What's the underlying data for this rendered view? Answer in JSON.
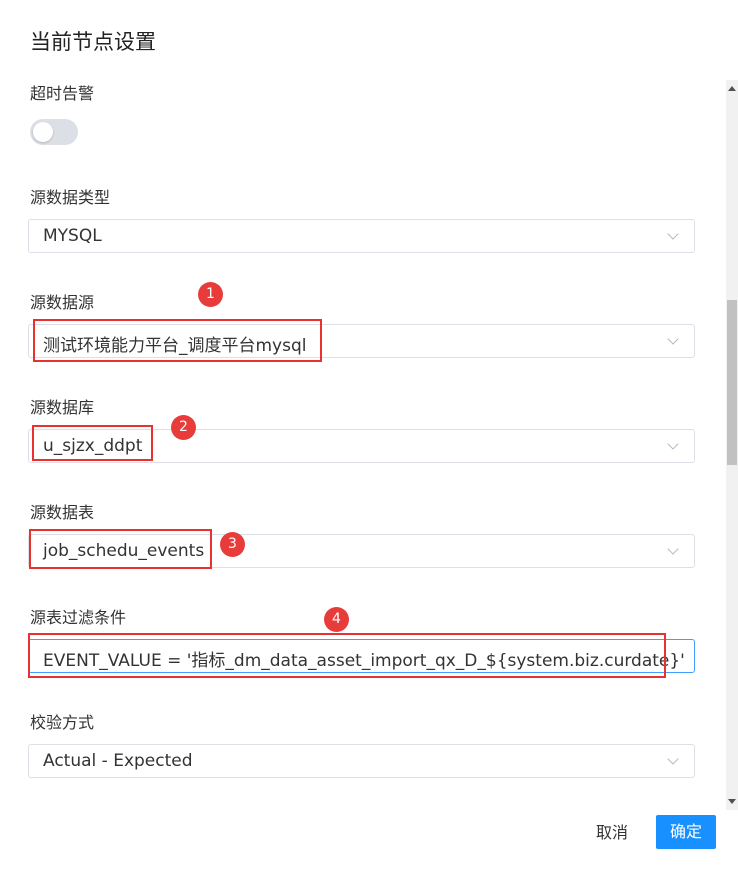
{
  "dialog": {
    "title": "当前节点设置",
    "cancel_label": "取消",
    "confirm_label": "确定"
  },
  "form": {
    "timeout_alarm": {
      "label": "超时告警",
      "enabled": false
    },
    "source_data_type": {
      "label": "源数据类型",
      "value": "MYSQL"
    },
    "source_datasource": {
      "label": "源数据源",
      "value": "测试环境能力平台_调度平台mysql"
    },
    "source_database": {
      "label": "源数据库",
      "value": "u_sjzx_ddpt"
    },
    "source_table": {
      "label": "源数据表",
      "value": "job_schedu_events"
    },
    "source_filter": {
      "label": "源表过滤条件",
      "value": "EVENT_VALUE = '指标_dm_data_asset_import_qx_D_${system.biz.curdate}'"
    },
    "check_method": {
      "label": "校验方式",
      "value": "Actual - Expected"
    }
  },
  "annotations": {
    "badge_1": "1",
    "badge_2": "2",
    "badge_3": "3",
    "badge_4": "4",
    "highlight_color": "#e8322f"
  },
  "colors": {
    "primary": "#1890ff",
    "focus_border": "#409eff"
  }
}
